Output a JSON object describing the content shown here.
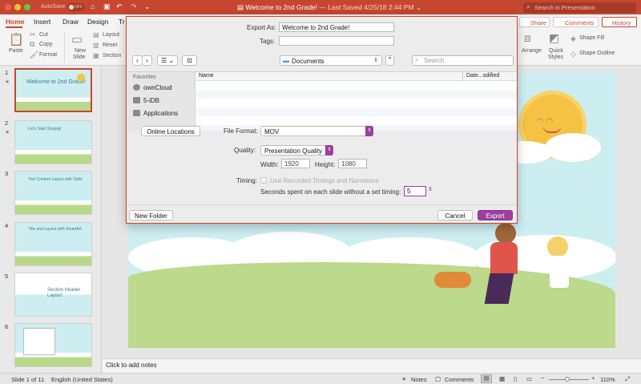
{
  "titlebar": {
    "autosave_label": "AutoSave",
    "autosave_state": "OFF",
    "document_title": "Welcome to 2nd Grade!",
    "saved_status": "— Last Saved 4/25/18 2:44 PM",
    "search_placeholder": "Search in Presentation"
  },
  "ribbon_tabs": [
    "Home",
    "Insert",
    "Draw",
    "Design",
    "Tr"
  ],
  "ribbon_right": {
    "share": "Share",
    "comments": "Comments",
    "history": "History"
  },
  "ribbon": {
    "paste": "Paste",
    "cut": "Cut",
    "copy": "Copy",
    "format": "Format",
    "new_slide_1": "New",
    "new_slide_2": "Slide",
    "layout": "Layout",
    "reset": "Reset",
    "section": "Section",
    "arrange": "Arrange",
    "quick_styles_1": "Quick",
    "quick_styles_2": "Styles",
    "shape_fill": "Shape Fill",
    "shape_outline": "Shape Outline"
  },
  "slides": [
    {
      "num": "1",
      "title_html": "Welcome to 2nd Grade!",
      "subtitle": "",
      "selected": true
    },
    {
      "num": "2",
      "title_html": "Let's Start Singing!",
      "subtitle": ""
    },
    {
      "num": "3",
      "title_html": "Two Content Layout with Table",
      "subtitle": ""
    },
    {
      "num": "4",
      "title_html": "Title and Layout with SmartArt",
      "subtitle": ""
    },
    {
      "num": "5",
      "title_html": "Section Header Layout",
      "subtitle": ""
    },
    {
      "num": "6",
      "title_html": "",
      "subtitle": ""
    }
  ],
  "dialog": {
    "export_as_label": "Export As:",
    "export_as_value": "Welcome to 2nd Grade!",
    "tags_label": "Tags:",
    "tags_value": "",
    "location": "Documents",
    "search_placeholder": "Search",
    "favorites_label": "Favorites",
    "favorites": [
      "ownCloud",
      "5-iDB",
      "Applications"
    ],
    "col_name": "Name",
    "col_date": "Date...odified",
    "online_locations": "Online Locations",
    "file_format_label": "File Format:",
    "file_format_value": "MOV",
    "quality_label": "Quality:",
    "quality_value": "Presentation Quality",
    "width_label": "Width:",
    "width_value": "1920",
    "height_label": "Height:",
    "height_value": "1080",
    "timing_label": "Timing:",
    "use_recorded": "Use Recorded Timings and Narrations",
    "seconds_label": "Seconds spent on each slide without a set timing:",
    "seconds_value": "5",
    "new_folder": "New Folder",
    "cancel": "Cancel",
    "export": "Export"
  },
  "notes_placeholder": "Click to add notes",
  "status": {
    "slide_of": "Slide 1 of 11",
    "language": "English (United States)",
    "notes": "Notes",
    "comments": "Comments",
    "zoom": "110%"
  },
  "colors": {
    "accent": "#c6462f",
    "purple": "#9c3f9f"
  }
}
